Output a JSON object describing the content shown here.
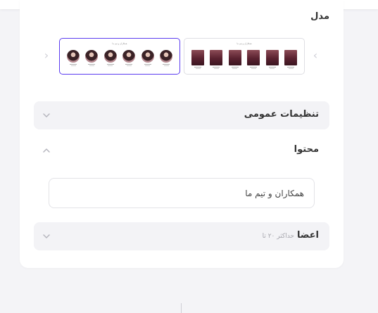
{
  "model": {
    "label": "مدل",
    "thumbnails": [
      {
        "title": "همکاران و تیم ما",
        "style": "rect",
        "members": 6,
        "selected": false
      },
      {
        "title": "همکاران و تیم ما",
        "style": "circle",
        "members": 6,
        "selected": true
      }
    ]
  },
  "sections": {
    "general": {
      "title": "تنظیمات عمومی"
    },
    "content": {
      "title": "محتوا",
      "field_value": "همکاران و تیم ما"
    },
    "members": {
      "title": "اعضا",
      "hint": "حداکثر ۲۰ تا"
    }
  },
  "icons": {
    "prev": "chevron-right-icon",
    "next": "chevron-left-icon",
    "collapse": "chevron-down-icon",
    "expand": "chevron-up-icon"
  },
  "colors": {
    "accent": "#5b3cf0",
    "panel": "#f3f3f6",
    "background": "#f4f4f7"
  }
}
